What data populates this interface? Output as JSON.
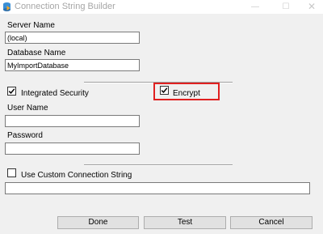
{
  "window": {
    "title": "Connection String Builder",
    "minimize_glyph": "—",
    "maximize_glyph": "☐",
    "close_glyph": "✕"
  },
  "form": {
    "server_name_label": "Server Name",
    "server_name_value": "(local)",
    "database_name_label": "Database Name",
    "database_name_value": "MyImportDatabase",
    "integrated_security_label": "Integrated Security",
    "integrated_security_checked": true,
    "encrypt_label": "Encrypt",
    "encrypt_checked": true,
    "user_name_label": "User Name",
    "user_name_value": "",
    "password_label": "Password",
    "password_value": "",
    "custom_connection_label": "Use Custom Connection String",
    "custom_connection_checked": false,
    "custom_connection_value": ""
  },
  "buttons": {
    "done": "Done",
    "test": "Test",
    "cancel": "Cancel"
  },
  "colors": {
    "highlight_border": "#e02020",
    "window_background": "#f0f0f0",
    "title_text": "#a6a6a6"
  }
}
